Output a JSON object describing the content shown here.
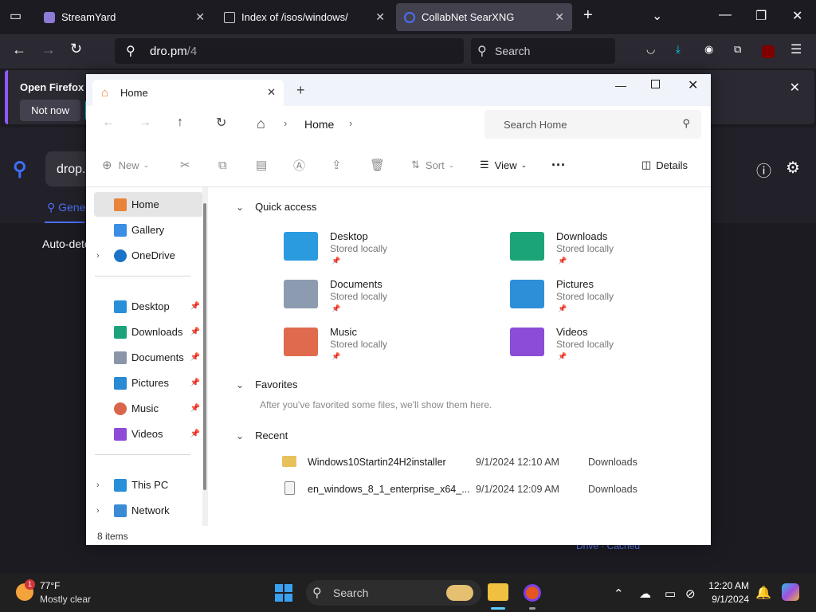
{
  "browser": {
    "tabs": [
      {
        "title": "StreamYard",
        "icon": "streamyard-icon"
      },
      {
        "title": "Index of /isos/windows/",
        "icon": "page-icon"
      },
      {
        "title": "CollabNet SearXNG",
        "icon": "searx-icon",
        "active": true
      }
    ],
    "url": "dro.pm/4",
    "url_prefix": "dro.pm",
    "url_path": "/4",
    "search_placeholder": "Search",
    "notification": {
      "text": "Open Firefox ev",
      "not_now": "Not now"
    },
    "page": {
      "search_value": "drop.",
      "tab_general": "Gene",
      "auto_detect": "Auto-dete",
      "footer": "Drive    ·    Cached"
    }
  },
  "explorer": {
    "tab_title": "Home",
    "address_home": "Home",
    "search_placeholder": "Search Home",
    "commands": {
      "new": "New",
      "sort": "Sort",
      "view": "View",
      "details": "Details"
    },
    "sidebar": {
      "top": [
        {
          "label": "Home",
          "icon": "home-icon",
          "color": "#e8833a"
        },
        {
          "label": "Gallery",
          "icon": "gallery-icon",
          "color": "#3a8ee6"
        },
        {
          "label": "OneDrive",
          "icon": "onedrive-icon",
          "color": "#1b73c8"
        }
      ],
      "pinned": [
        {
          "label": "Desktop",
          "icon": "desktop-icon",
          "color": "#2a8fd9"
        },
        {
          "label": "Downloads",
          "icon": "downloads-icon",
          "color": "#1aa37a"
        },
        {
          "label": "Documents",
          "icon": "documents-icon",
          "color": "#8a96a8"
        },
        {
          "label": "Pictures",
          "icon": "pictures-icon",
          "color": "#2b8ad4"
        },
        {
          "label": "Music",
          "icon": "music-icon",
          "color": "#d9664a"
        },
        {
          "label": "Videos",
          "icon": "videos-icon",
          "color": "#8e4bd8"
        }
      ],
      "bottom": [
        {
          "label": "This PC",
          "icon": "this-pc-icon",
          "color": "#2a8fd9"
        },
        {
          "label": "Network",
          "icon": "network-icon",
          "color": "#3b8bd4"
        }
      ]
    },
    "quick_access": {
      "heading": "Quick access",
      "items": [
        {
          "name": "Desktop",
          "sub": "Stored locally",
          "icon": "desktop-folder-icon",
          "color": "#2b9be0"
        },
        {
          "name": "Downloads",
          "sub": "Stored locally",
          "icon": "downloads-folder-icon",
          "color": "#1ba477"
        },
        {
          "name": "Documents",
          "sub": "Stored locally",
          "icon": "documents-folder-icon",
          "color": "#8c9bb0"
        },
        {
          "name": "Pictures",
          "sub": "Stored locally",
          "icon": "pictures-folder-icon",
          "color": "#2d8fd8"
        },
        {
          "name": "Music",
          "sub": "Stored locally",
          "icon": "music-folder-icon",
          "color": "#e06a4e"
        },
        {
          "name": "Videos",
          "sub": "Stored locally",
          "icon": "videos-folder-icon",
          "color": "#8d4cd6"
        }
      ]
    },
    "favorites": {
      "heading": "Favorites",
      "empty": "After you've favorited some files, we'll show them here."
    },
    "recent": {
      "heading": "Recent",
      "items": [
        {
          "name": "Windows10Startin24H2installer",
          "date": "9/1/2024 12:10 AM",
          "location": "Downloads"
        },
        {
          "name": "en_windows_8_1_enterprise_x64_...",
          "date": "9/1/2024 12:09 AM",
          "location": "Downloads"
        }
      ]
    },
    "status": "8 items"
  },
  "taskbar": {
    "weather_temp": "77°F",
    "weather_desc": "Mostly clear",
    "weather_badge": "1",
    "search": "Search",
    "time": "12:20 AM",
    "date": "9/1/2024"
  }
}
